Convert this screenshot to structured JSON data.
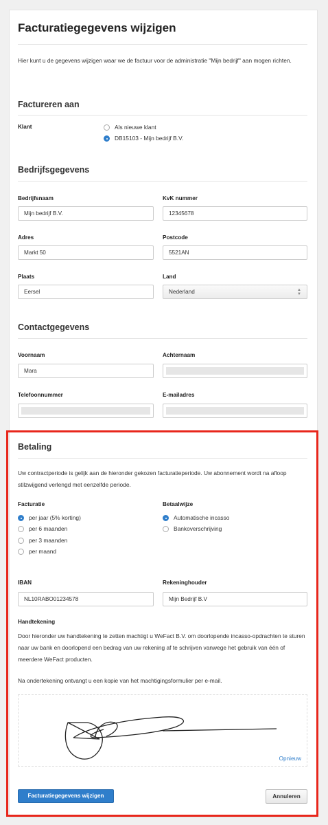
{
  "page_title": "Facturatiegegevens wijzigen",
  "intro": "Hier kunt u de gegevens wijzigen waar we de factuur voor de administratie \"Mijn bedrijf\" aan mogen richten.",
  "factureren": {
    "heading": "Factureren aan",
    "klant_label": "Klant",
    "options": [
      "Als nieuwe klant",
      "DB15103 - Mijn bedrijf B.V."
    ],
    "selected_index": 1
  },
  "bedrijf": {
    "heading": "Bedrijfsgegevens",
    "bedrijfsnaam_label": "Bedrijfsnaam",
    "bedrijfsnaam": "Mijn bedrijf B.V.",
    "kvk_label": "KvK nummer",
    "kvk": "12345678",
    "adres_label": "Adres",
    "adres": "Markt 50",
    "postcode_label": "Postcode",
    "postcode": "5521AN",
    "plaats_label": "Plaats",
    "plaats": "Eersel",
    "land_label": "Land",
    "land": "Nederland"
  },
  "contact": {
    "heading": "Contactgegevens",
    "voornaam_label": "Voornaam",
    "voornaam": "Mara",
    "achternaam_label": "Achternaam",
    "telefoon_label": "Telefoonnummer",
    "email_label": "E-mailadres"
  },
  "betaling": {
    "heading": "Betaling",
    "description": "Uw contractperiode is gelijk aan de hieronder gekozen facturatieperiode. Uw abonnement wordt na afloop stilzwijgend verlengd met eenzelfde periode.",
    "facturatie_label": "Facturatie",
    "facturatie_options": [
      "per jaar (5% korting)",
      "per 6 maanden",
      "per 3 maanden",
      "per maand"
    ],
    "facturatie_selected": 0,
    "betaalwijze_label": "Betaalwijze",
    "betaalwijze_options": [
      "Automatische incasso",
      "Bankoverschrijving"
    ],
    "betaalwijze_selected": 0,
    "iban_label": "IBAN",
    "iban": "NL10RABO01234578",
    "rekeninghouder_label": "Rekeninghouder",
    "rekeninghouder": "Mijn Bedrijf B.V",
    "handtekening_label": "Handtekening",
    "mandate_text": "Door hieronder uw handtekening te zetten machtigt u WeFact B.V. om doorlopende incasso-opdrachten te sturen naar uw bank en doorlopend een bedrag van uw rekening af te schrijven vanwege het gebruik van één of meerdere WeFact producten.",
    "copy_text": "Na ondertekening ontvangt u een kopie van het machtigingsformulier per e-mail.",
    "opnieuw": "Opnieuw"
  },
  "actions": {
    "submit": "Facturatiegegevens wijzigen",
    "cancel": "Annuleren"
  },
  "colors": {
    "accent": "#2f7ecb",
    "highlight": "#e8261b"
  }
}
